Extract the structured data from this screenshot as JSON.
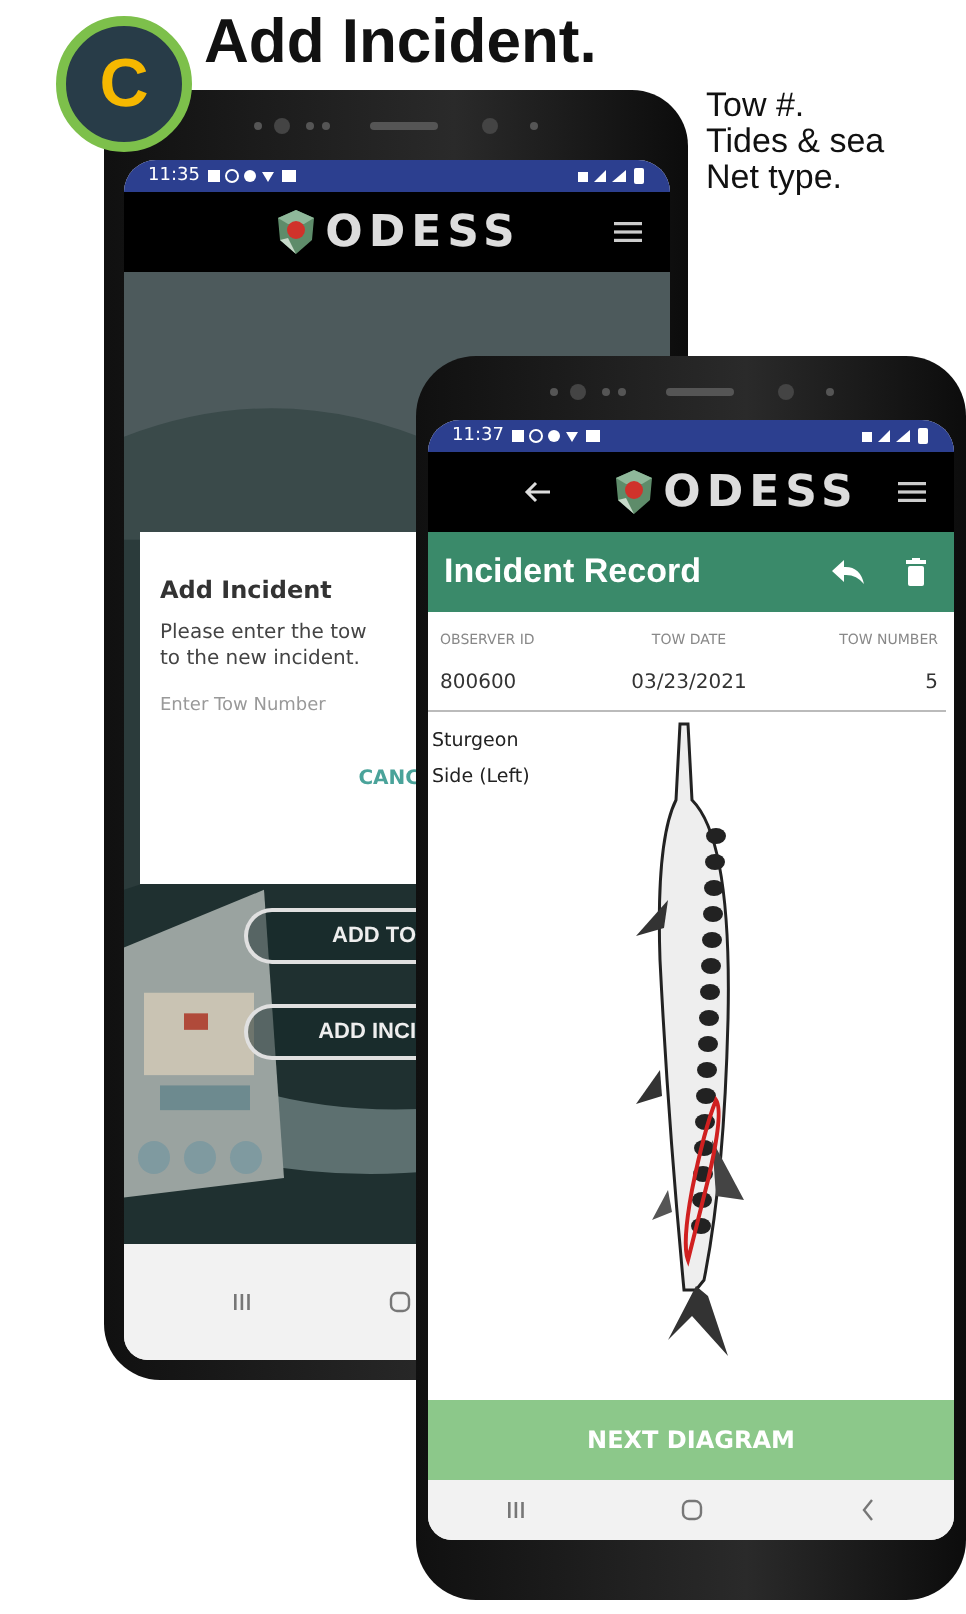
{
  "badge": {
    "letter": "C"
  },
  "title": "Add Incident.",
  "notes": [
    "Tow #.",
    "Tides & sea",
    "Net type."
  ],
  "back_phone": {
    "status_time": "11:35",
    "app_name": "ODESS",
    "dialog": {
      "title": "Add Incident",
      "message_lines": [
        "Please enter the tow",
        "to the new incident."
      ],
      "placeholder": "Enter Tow Number",
      "action": "CANC"
    },
    "buttons": [
      "ADD TO",
      "ADD INCI"
    ]
  },
  "front_phone": {
    "status_time": "11:37",
    "app_name": "ODESS",
    "toolbar_title": "Incident Record",
    "columns": [
      {
        "label": "OBSERVER ID",
        "value": "800600"
      },
      {
        "label": "TOW DATE",
        "value": "03/23/2021"
      },
      {
        "label": "TOW NUMBER",
        "value": "5"
      }
    ],
    "diagram_labels": [
      "Sturgeon",
      "Side (Left)"
    ],
    "next_button": "NEXT DIAGRAM"
  }
}
